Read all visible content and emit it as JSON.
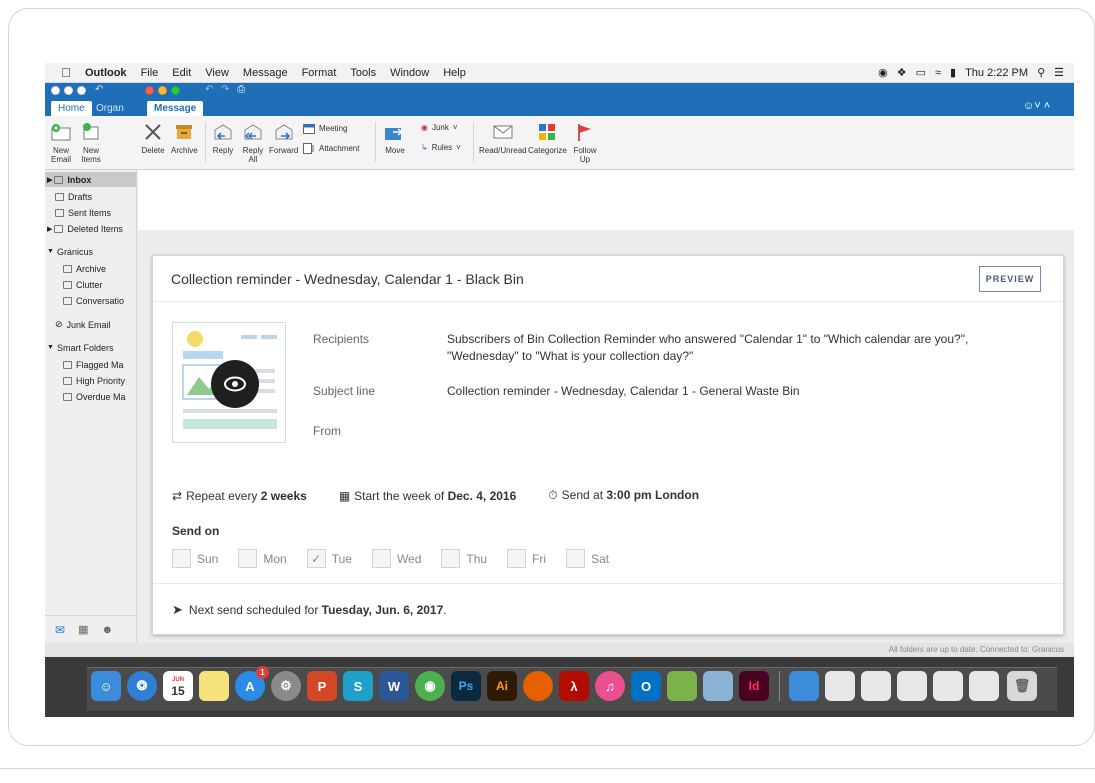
{
  "menubar": {
    "app_name": "Outlook",
    "items": [
      "File",
      "Edit",
      "View",
      "Message",
      "Format",
      "Tools",
      "Window",
      "Help"
    ],
    "clock": "Thu 2:22 PM"
  },
  "tabs": {
    "main": [
      "Home",
      "Organ"
    ],
    "message_window": "Message"
  },
  "ribbon": {
    "new_email": "New\nEmail",
    "new_items": "New\nItems",
    "delete": "Delete",
    "archive": "Archive",
    "reply": "Reply",
    "reply_all": "Reply\nAll",
    "forward": "Forward",
    "meeting": "Meeting",
    "attachment": "Attachment",
    "move": "Move",
    "junk": "Junk",
    "rules": "Rules",
    "read_unread": "Read/Unread",
    "categorize": "Categorize",
    "follow_up": "Follow\nUp"
  },
  "sidebar": {
    "items": [
      {
        "label": "Inbox",
        "selected": true
      },
      {
        "label": "Drafts"
      },
      {
        "label": "Sent Items"
      },
      {
        "label": "Deleted Items"
      },
      {
        "label": "Granicus"
      },
      {
        "label": "Archive"
      },
      {
        "label": "Clutter"
      },
      {
        "label": "Conversatio"
      },
      {
        "label": "Junk Email"
      },
      {
        "label": "Smart Folders"
      },
      {
        "label": "Flagged Ma"
      },
      {
        "label": "High Priority"
      },
      {
        "label": "Overdue Ma"
      }
    ]
  },
  "status": {
    "text": "All folders are up to date.    Connected to: Granicus"
  },
  "card": {
    "title": "Collection reminder - Wednesday, Calendar 1 - Black Bin",
    "preview_label": "PREVIEW",
    "fields": {
      "recipients_label": "Recipients",
      "recipients_value": "Subscribers of Bin Collection Reminder who answered \"Calendar 1\" to \"Which calendar are you?\", \"Wednesday\" to \"What is your collection day?\"",
      "subject_label": "Subject line",
      "subject_value": "Collection reminder - Wednesday, Calendar 1 - General Waste Bin",
      "from_label": "From"
    },
    "schedule": {
      "repeat_prefix": "Repeat every",
      "repeat_value": "2 weeks",
      "start_prefix": "Start the week of",
      "start_value": "Dec. 4, 2016",
      "send_prefix": "Send at",
      "send_value": "3:00 pm London"
    },
    "send_on_label": "Send on",
    "days": [
      {
        "label": "Sun",
        "checked": false
      },
      {
        "label": "Mon",
        "checked": false
      },
      {
        "label": "Tue",
        "checked": true
      },
      {
        "label": "Wed",
        "checked": false
      },
      {
        "label": "Thu",
        "checked": false
      },
      {
        "label": "Fri",
        "checked": false
      },
      {
        "label": "Sat",
        "checked": false
      }
    ],
    "next_send_prefix": "Next send scheduled for",
    "next_send_value": "Tuesday, Jun. 6, 2017",
    "next_send_suffix": "."
  },
  "dock": {
    "calendar_month": "JUN",
    "calendar_day": "15",
    "appstore_badge": "1",
    "photoshop": "Ps",
    "illustrator": "Ai",
    "indesign": "Id"
  }
}
